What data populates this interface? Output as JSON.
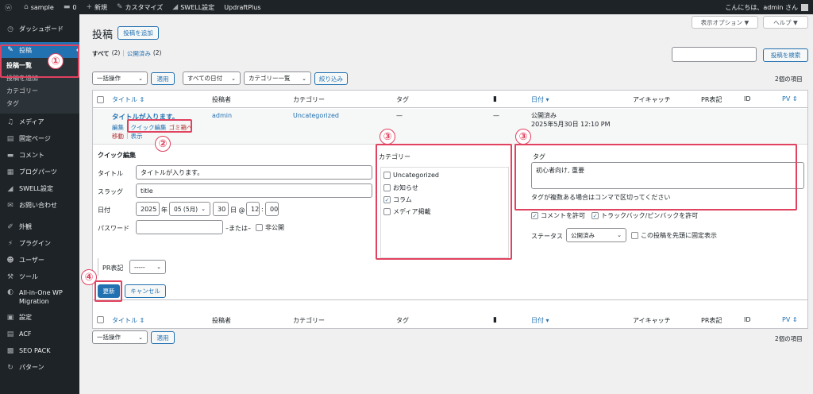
{
  "adminbar": {
    "site": "sample",
    "comments": "0",
    "new": "新規",
    "customize": "カスタマイズ",
    "swell": "SWELL設定",
    "updraft": "UpdraftPlus",
    "greeting": "こんにちは、admin さん"
  },
  "sidebar": {
    "dashboard": "ダッシュボード",
    "posts": "投稿",
    "sub": [
      "投稿一覧",
      "投稿を追加",
      "カテゴリー",
      "タグ"
    ],
    "items": [
      "メディア",
      "固定ページ",
      "コメント",
      "ブログパーツ",
      "SWELL設定",
      "お問い合わせ",
      "外観",
      "プラグイン",
      "ユーザー",
      "ツール",
      "All-in-One WP Migration",
      "設定",
      "ACF",
      "SEO PACK",
      "パターン"
    ]
  },
  "header": {
    "title": "投稿",
    "add_new": "投稿を追加",
    "screen_options": "表示オプション ▼",
    "help": "ヘルプ ▼"
  },
  "filters": {
    "all": "すべて",
    "all_count": "(2)",
    "sep": "|",
    "published": "公開済み",
    "published_count": "(2)",
    "search_button": "投稿を検索",
    "bulk": "一括操作",
    "apply": "適用",
    "dates": "すべての日付",
    "cats": "カテゴリー一覧",
    "filter": "絞り込み",
    "count": "2個の項目"
  },
  "columns": {
    "title": "タイトル ⇕",
    "author": "投稿者",
    "category": "カテゴリー",
    "tags": "タグ",
    "date": "日付 ▾",
    "eyecatch": "アイキャッチ",
    "pr": "PR表記",
    "id": "ID",
    "pv": "PV ⇕"
  },
  "row": {
    "title": "タイトルが入ります。",
    "author": "admin",
    "category": "Uncategorized",
    "tags": "—",
    "comments": "—",
    "status": "公開済み",
    "date": "2025年5月30日 12:10 PM",
    "edit": "編集",
    "sep": "|",
    "quick_edit": "クイック編集",
    "trash": "ゴミ箱へ",
    "move": "移動",
    "view": "表示"
  },
  "quick": {
    "heading": "クイック編集",
    "title_label": "タイトル",
    "title_value": "タイトルが入ります。",
    "slug_label": "スラッグ",
    "slug_value": "title",
    "date_label": "日付",
    "year": "2025",
    "year_suffix": "年",
    "month": "05 (5月)",
    "day": "30",
    "day_suffix": "日 @",
    "hour": "12",
    "colon": ":",
    "minute": "00",
    "password_label": "パスワード",
    "or": "–または–",
    "private": "非公開",
    "cat_heading": "カテゴリー",
    "cats": [
      "Uncategorized",
      "お知らせ",
      "コラム",
      "メディア掲載"
    ],
    "cats_checked": [
      false,
      false,
      true,
      false
    ],
    "tag_heading": "タグ",
    "tags_value": "初心者向け, 重要",
    "tag_hint": "タグが複数ある場合はコンマで区切ってください",
    "allow_comments": "コメントを許可",
    "allow_pings": "トラックバック/ピンバックを許可",
    "status_label": "ステータス",
    "status_value": "公開済み",
    "sticky": "この投稿を先頭に固定表示",
    "pr_label": "PR表記",
    "pr_value": "-----",
    "update": "更新",
    "cancel": "キャンセル"
  },
  "annotations": [
    "①",
    "②",
    "③",
    "③",
    "④"
  ],
  "colors": {
    "accent": "#2271b1",
    "annotation": "#e0425f",
    "adminbar": "#1d2327"
  }
}
